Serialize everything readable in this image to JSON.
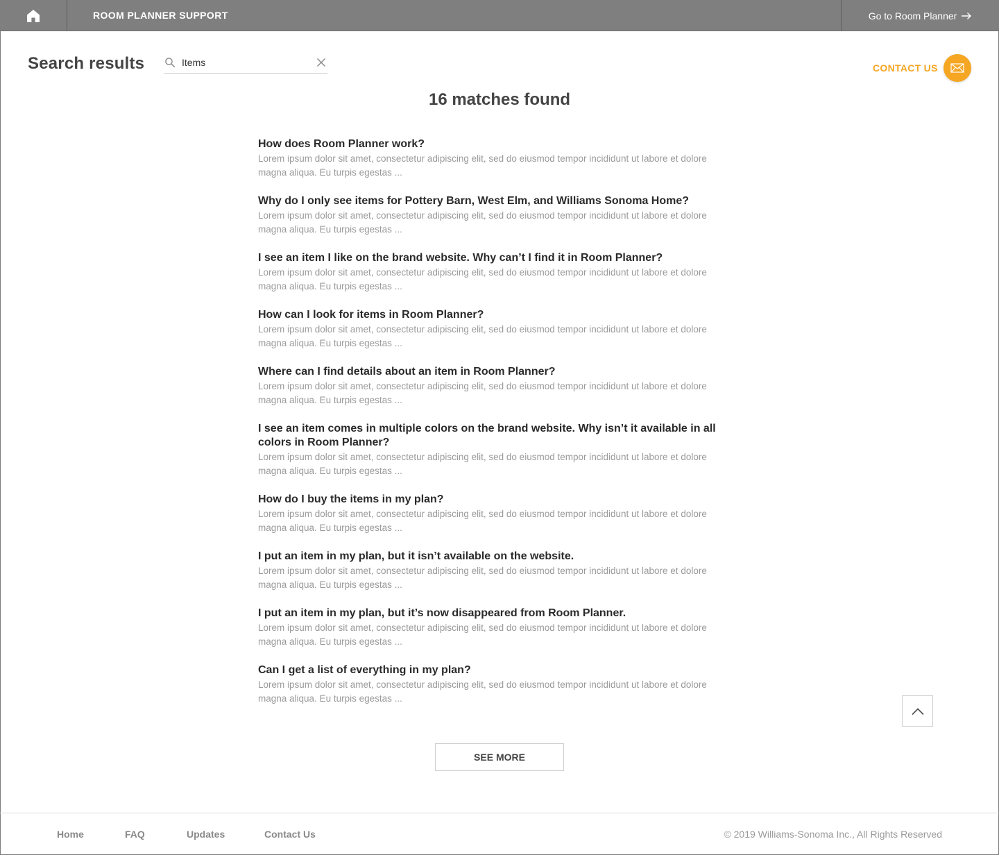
{
  "topbar": {
    "home_icon": "home-icon",
    "title": "ROOM PLANNER SUPPORT",
    "goto_label": "Go to Room Planner",
    "goto_icon": "arrow-right-icon",
    "background": "#7f7f7f"
  },
  "header": {
    "title": "Search results",
    "search": {
      "value": "Items",
      "icon": "search-icon",
      "clear_icon": "close-icon"
    },
    "contact": {
      "label": "CONTACT US",
      "icon": "mail-icon",
      "accent": "#f5a623"
    }
  },
  "summary": "16 matches found",
  "results": [
    {
      "title": "How does Room Planner work?",
      "snippet": "Lorem ipsum dolor sit amet, consectetur adipiscing elit, sed do eiusmod tempor incididunt ut labore et dolore magna aliqua. Eu turpis egestas ..."
    },
    {
      "title": "Why do I only see items for Pottery Barn, West Elm, and Williams Sonoma Home?",
      "snippet": "Lorem ipsum dolor sit amet, consectetur adipiscing elit, sed do eiusmod tempor incididunt ut labore et dolore magna aliqua. Eu turpis egestas ..."
    },
    {
      "title": "I see an item I like on the brand website. Why can’t I find it in Room Planner?",
      "snippet": "Lorem ipsum dolor sit amet, consectetur adipiscing elit, sed do eiusmod tempor incididunt ut labore et dolore magna aliqua. Eu turpis egestas ..."
    },
    {
      "title": "How can I look for items in Room Planner?",
      "snippet": "Lorem ipsum dolor sit amet, consectetur adipiscing elit, sed do eiusmod tempor incididunt ut labore et dolore magna aliqua. Eu turpis egestas ..."
    },
    {
      "title": "Where can I find details about an item in Room Planner?",
      "snippet": "Lorem ipsum dolor sit amet, consectetur adipiscing elit, sed do eiusmod tempor incididunt ut labore et dolore magna aliqua. Eu turpis egestas ..."
    },
    {
      "title": "I see an item comes in multiple colors on the brand website. Why isn’t it available in all colors in Room Planner?",
      "snippet": "Lorem ipsum dolor sit amet, consectetur adipiscing elit, sed do eiusmod tempor incididunt ut labore et dolore magna aliqua. Eu turpis egestas ..."
    },
    {
      "title": "How do I buy the items in my plan?",
      "snippet": "Lorem ipsum dolor sit amet, consectetur adipiscing elit, sed do eiusmod tempor incididunt ut labore et dolore magna aliqua. Eu turpis egestas ..."
    },
    {
      "title": "I put an item in my plan, but it isn’t available on the website.",
      "snippet": "Lorem ipsum dolor sit amet, consectetur adipiscing elit, sed do eiusmod tempor incididunt ut labore et dolore magna aliqua. Eu turpis egestas ..."
    },
    {
      "title": "I put an item in my plan, but it’s now disappeared from Room Planner.",
      "snippet": "Lorem ipsum dolor sit amet, consectetur adipiscing elit, sed do eiusmod tempor incididunt ut labore et dolore magna aliqua. Eu turpis egestas ..."
    },
    {
      "title": "Can I get a list of everything in my plan?",
      "snippet": "Lorem ipsum dolor sit amet, consectetur adipiscing elit, sed do eiusmod tempor incididunt ut labore et dolore magna aliqua. Eu turpis egestas ..."
    }
  ],
  "see_more_label": "SEE MORE",
  "back_to_top_icon": "chevron-up-icon",
  "footer": {
    "links": [
      "Home",
      "FAQ",
      "Updates",
      "Contact Us"
    ],
    "copyright": "© 2019 Williams-Sonoma Inc., All Rights Reserved"
  }
}
